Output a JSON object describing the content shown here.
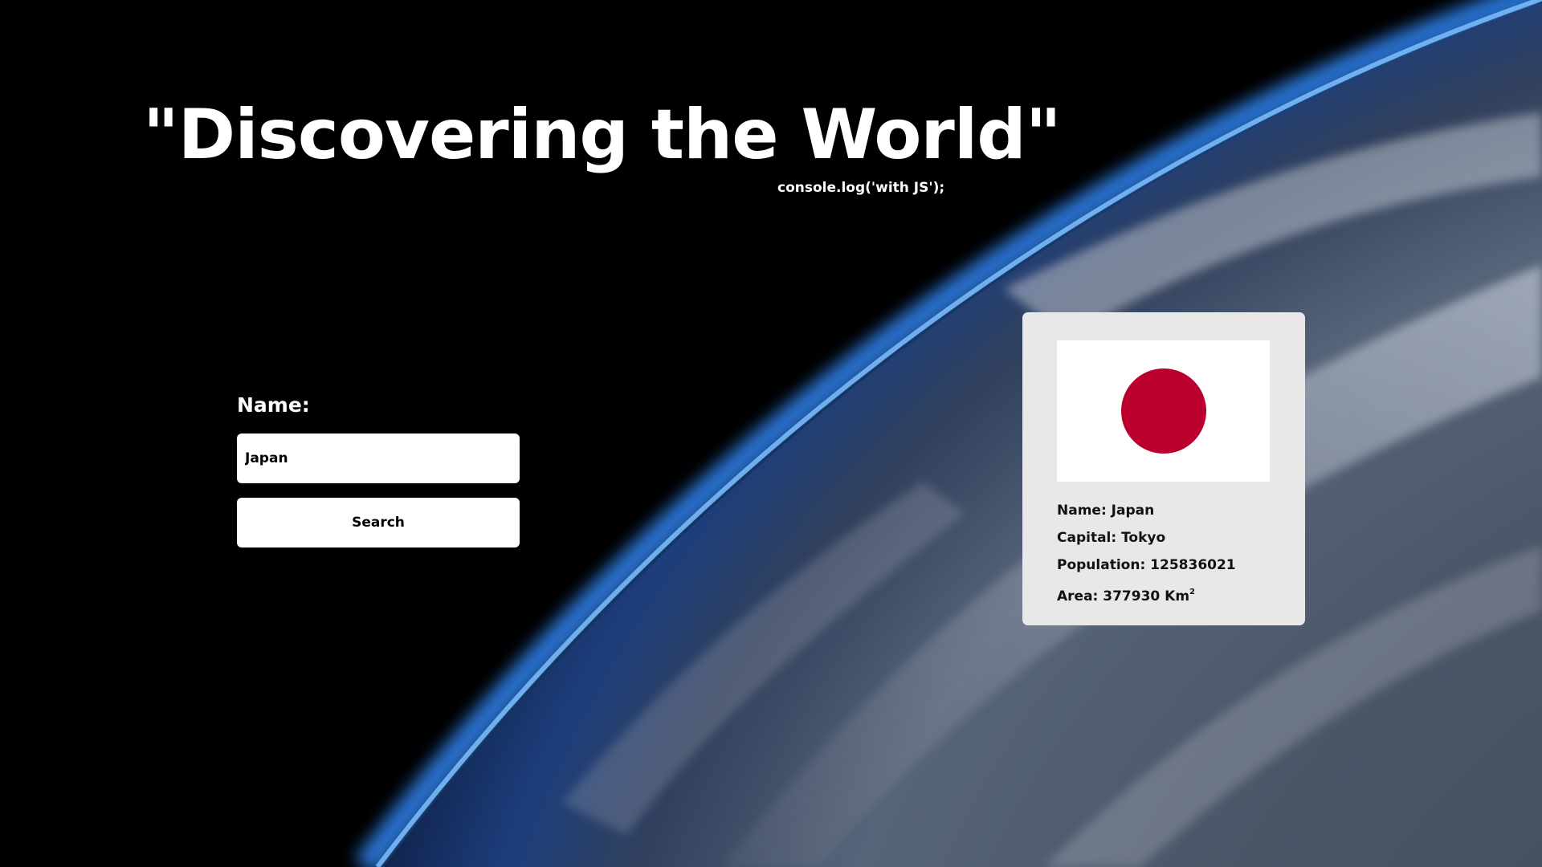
{
  "header": {
    "title": "\"Discovering the World\"",
    "subtitle": "console.log('with JS');"
  },
  "search": {
    "label": "Name:",
    "input_value": "Japan",
    "button_label": "Search"
  },
  "result": {
    "flag": {
      "background": "#ffffff",
      "disc_color": "#bc002d"
    },
    "name_label": "Name:",
    "name": "Japan",
    "capital_label": "Capital:",
    "capital": "Tokyo",
    "population_label": "Population:",
    "population": "125836021",
    "area_label": "Area:",
    "area": "377930 Km",
    "area_unit_exp": "2"
  },
  "colors": {
    "atmosphere": "#2f7fe6",
    "card_bg": "#e8e8e8"
  }
}
